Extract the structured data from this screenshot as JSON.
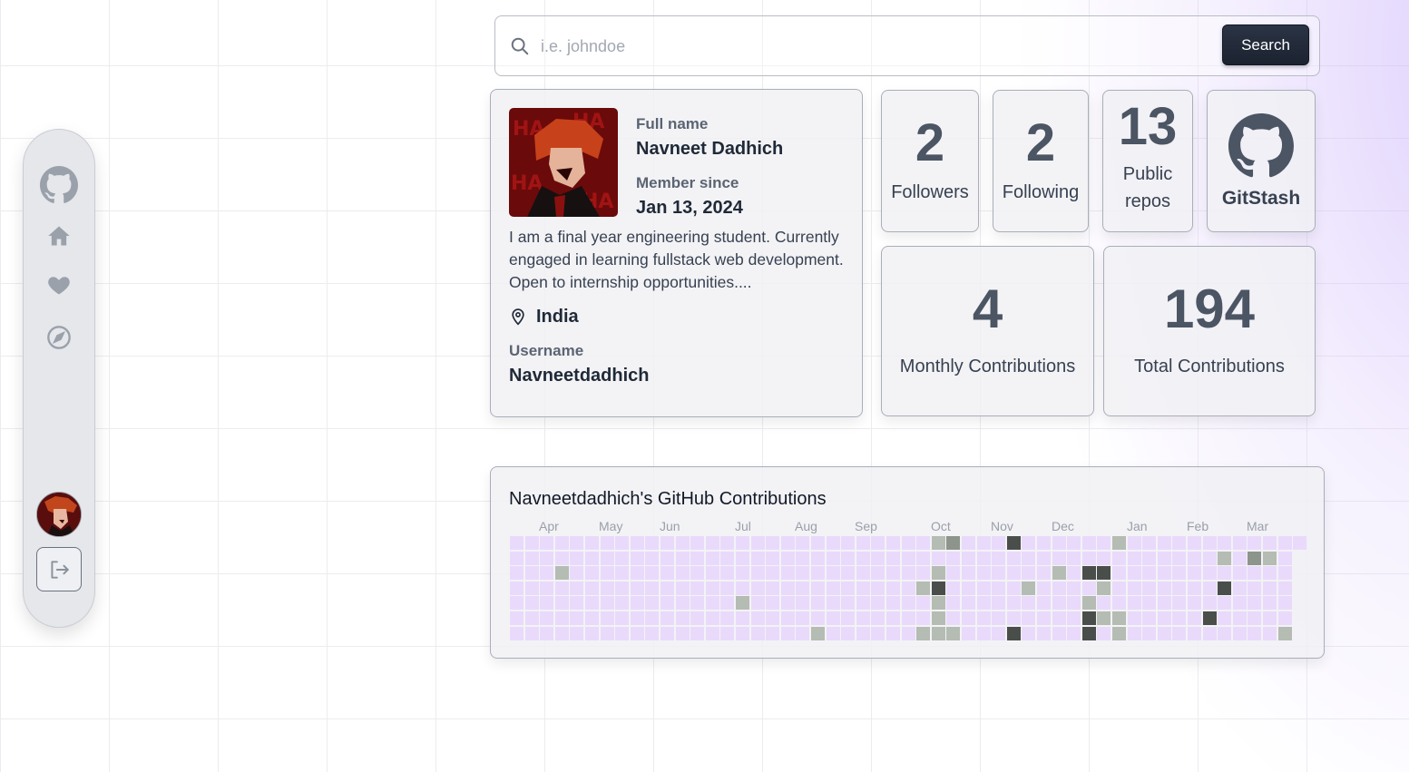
{
  "search": {
    "placeholder": "i.e. johndoe",
    "value": "",
    "button_label": "Search"
  },
  "sidebar": {
    "items": [
      "github-logo",
      "home",
      "favorites",
      "explore"
    ]
  },
  "profile": {
    "full_name_label": "Full name",
    "full_name": "Navneet Dadhich",
    "member_since_label": "Member since",
    "member_since": "Jan 13, 2024",
    "bio": "I am a final year engineering student. Currently engaged in learning fullstack web development. Open to internship opportunities....",
    "location": "India",
    "username_label": "Username",
    "username": "Navneetdadhich"
  },
  "stats": {
    "followers": {
      "value": "2",
      "label": "Followers"
    },
    "following": {
      "value": "2",
      "label": "Following"
    },
    "repos": {
      "value": "13",
      "label_line1": "Public",
      "label_line2": "repos"
    },
    "brand": {
      "label": "GitStash"
    },
    "monthly": {
      "value": "4",
      "label": "Monthly Contributions"
    },
    "total": {
      "value": "194",
      "label": "Total Contributions"
    }
  },
  "contributions": {
    "title": "Navneetdadhich's GitHub Contributions",
    "months": [
      "Apr",
      "May",
      "Jun",
      "Jul",
      "Aug",
      "Sep",
      "Oct",
      "Nov",
      "Dec",
      "Jan",
      "Feb",
      "Mar"
    ],
    "weeks": 53,
    "days": 7,
    "last_week_days": 1,
    "colors": {
      "level0": "#e9dafb",
      "level1": "#b5bcb3",
      "level2": "#8d948b",
      "level3": "#4a4e4b"
    },
    "active_cells": [
      [
        28,
        0,
        1
      ],
      [
        29,
        0,
        2
      ],
      [
        33,
        0,
        3
      ],
      [
        40,
        0,
        1
      ],
      [
        47,
        1,
        1
      ],
      [
        49,
        1,
        2
      ],
      [
        50,
        1,
        1
      ],
      [
        3,
        2,
        1
      ],
      [
        28,
        2,
        1
      ],
      [
        36,
        2,
        1
      ],
      [
        38,
        2,
        3
      ],
      [
        39,
        2,
        3
      ],
      [
        27,
        3,
        1
      ],
      [
        28,
        3,
        3
      ],
      [
        34,
        3,
        1
      ],
      [
        39,
        3,
        1
      ],
      [
        47,
        3,
        3
      ],
      [
        15,
        4,
        1
      ],
      [
        28,
        4,
        1
      ],
      [
        38,
        4,
        1
      ],
      [
        28,
        5,
        1
      ],
      [
        38,
        5,
        3
      ],
      [
        39,
        5,
        1
      ],
      [
        40,
        5,
        1
      ],
      [
        46,
        5,
        3
      ],
      [
        20,
        6,
        1
      ],
      [
        27,
        6,
        1
      ],
      [
        28,
        6,
        1
      ],
      [
        29,
        6,
        1
      ],
      [
        33,
        6,
        3
      ],
      [
        38,
        6,
        3
      ],
      [
        40,
        6,
        1
      ],
      [
        51,
        6,
        1
      ]
    ]
  }
}
